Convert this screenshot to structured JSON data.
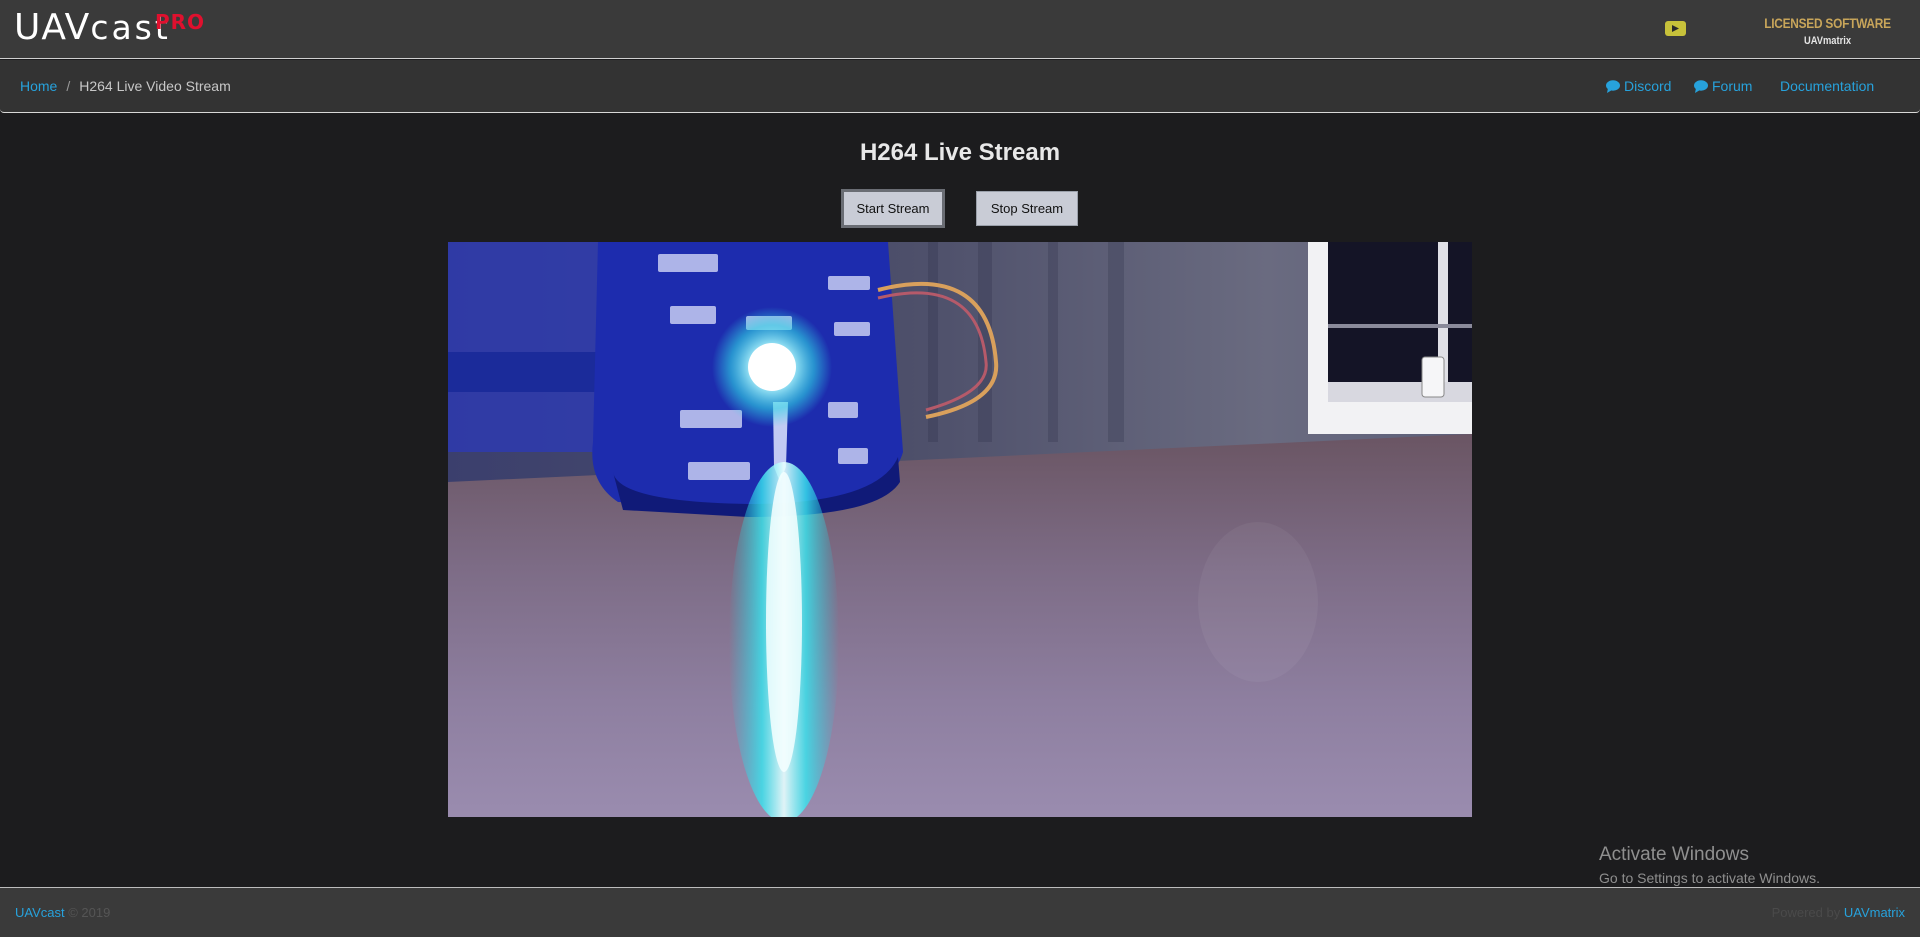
{
  "header": {
    "logo_main": "UAV",
    "logo_sub": "cast",
    "logo_badge": "PRO",
    "license_line1": "LICENSED SOFTWARE",
    "license_line2": "UAVmatrix",
    "youtube_icon": "youtube-icon"
  },
  "breadcrumb": {
    "home": "Home",
    "separator": "/",
    "current": "H264 Live Video Stream"
  },
  "nav": {
    "discord": "Discord",
    "forum": "Forum",
    "documentation": "Documentation"
  },
  "main": {
    "title": "H264 Live Stream",
    "start_label": "Start Stream",
    "stop_label": "Stop Stream"
  },
  "watermark": {
    "line1": "Activate Windows",
    "line2": "Go to Settings to activate Windows."
  },
  "footer": {
    "brand": "UAVcast",
    "copyright": " © 2019",
    "powered": "Powered by ",
    "powered_brand": "UAVmatrix"
  },
  "colors": {
    "accent": "#27a2dc",
    "pro_badge": "#e0102e",
    "license": "#c8a55a",
    "youtube": "#c7c13a"
  }
}
